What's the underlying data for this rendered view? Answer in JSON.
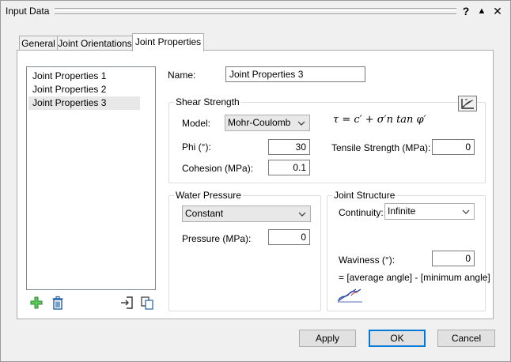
{
  "window": {
    "title": "Input Data",
    "help_glyph": "?",
    "collapse_glyph": "▲",
    "close_glyph": "✕"
  },
  "tabs": [
    {
      "label": "General",
      "active": false
    },
    {
      "label": "Joint Orientations",
      "active": false
    },
    {
      "label": "Joint Properties",
      "active": true
    }
  ],
  "list": {
    "items": [
      "Joint Properties 1",
      "Joint Properties 2",
      "Joint Properties 3"
    ],
    "selected_index": 2
  },
  "name": {
    "label": "Name:",
    "value": "Joint Properties 3"
  },
  "shear_strength": {
    "title": "Shear Strength",
    "model_label": "Model:",
    "model_value": "Mohr-Coulomb",
    "phi_label": "Phi (°):",
    "phi_value": "30",
    "cohesion_label": "Cohesion (MPa):",
    "cohesion_value": "0.1",
    "tensile_label": "Tensile Strength (MPa):",
    "tensile_value": "0",
    "formula": "τ = c′ + σ′n tan φ′"
  },
  "water_pressure": {
    "title": "Water Pressure",
    "type_value": "Constant",
    "pressure_label": "Pressure (MPa):",
    "pressure_value": "0"
  },
  "joint_structure": {
    "title": "Joint Structure",
    "continuity_label": "Continuity:",
    "continuity_value": "Infinite",
    "waviness_label": "Waviness (°):",
    "waviness_value": "0",
    "waviness_note": "= [average angle] - [minimum angle]"
  },
  "buttons": {
    "apply": "Apply",
    "ok": "OK",
    "cancel": "Cancel"
  },
  "colors": {
    "accent": "#0078d7",
    "add_icon": "#3cb043",
    "delete_icon": "#1f5fa8"
  }
}
